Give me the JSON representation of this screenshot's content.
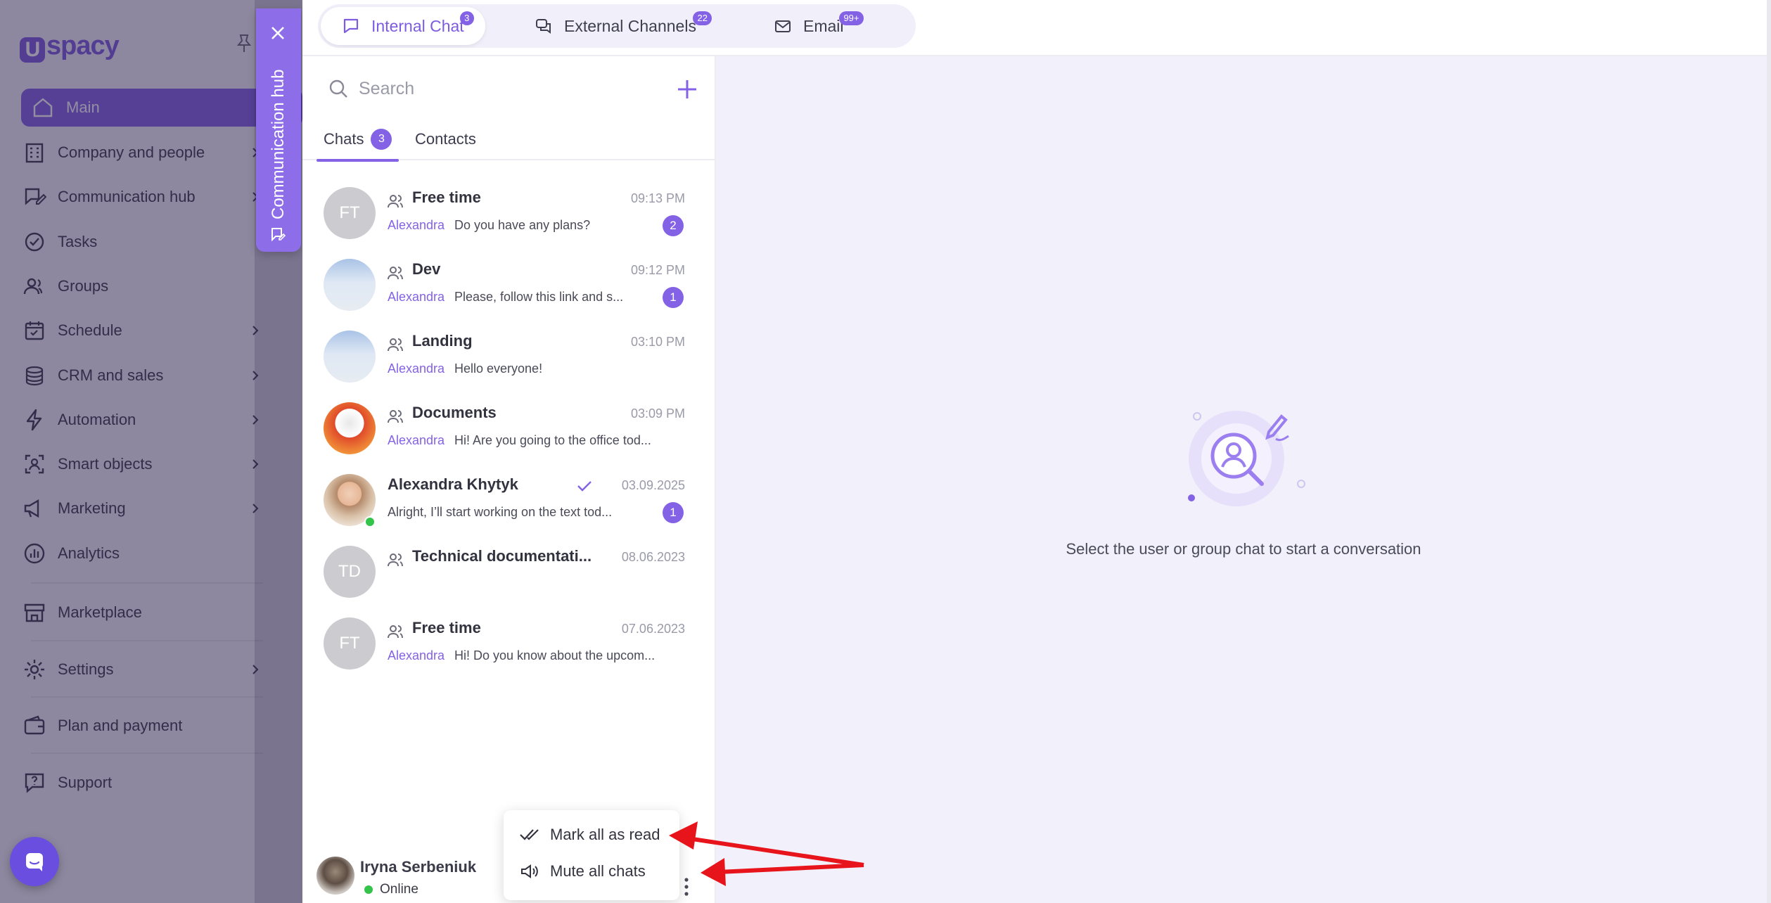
{
  "sidebar": {
    "logo": "spacy",
    "items": [
      {
        "label": "Main"
      },
      {
        "label": "Company and people"
      },
      {
        "label": "Communication hub"
      },
      {
        "label": "Tasks"
      },
      {
        "label": "Groups"
      },
      {
        "label": "Schedule"
      },
      {
        "label": "CRM and sales"
      },
      {
        "label": "Automation"
      },
      {
        "label": "Smart objects"
      },
      {
        "label": "Marketing"
      },
      {
        "label": "Analytics"
      },
      {
        "label": "Marketplace"
      },
      {
        "label": "Settings"
      },
      {
        "label": "Plan and payment"
      },
      {
        "label": "Support"
      }
    ],
    "hub_tab_label": "Communication hub"
  },
  "top_tabs": [
    {
      "label": "Internal Chat",
      "count": "3"
    },
    {
      "label": "External Channels",
      "count": "22"
    },
    {
      "label": "Email",
      "count": "99+"
    }
  ],
  "search": {
    "placeholder": "Search"
  },
  "list_tabs": {
    "chats_label": "Chats",
    "chats_count": "3",
    "contacts_label": "Contacts"
  },
  "chats": [
    {
      "initials": "FT",
      "name": "Free time",
      "time": "09:13 PM",
      "author": "Alexandra",
      "preview": "Do you have any plans?",
      "unread": "2"
    },
    {
      "name": "Dev",
      "time": "09:12 PM",
      "author": "Alexandra",
      "preview": "Please, follow this link and s...",
      "unread": "1"
    },
    {
      "name": "Landing",
      "time": "03:10 PM",
      "author": "Alexandra",
      "preview": "Hello everyone!"
    },
    {
      "name": "Documents",
      "time": "03:09 PM",
      "author": "Alexandra",
      "preview": "Hi! Are you going to the office tod..."
    },
    {
      "name": "Alexandra Khytyk",
      "time": "03.09.2025",
      "preview": "Alright, I’ll start working on the text tod...",
      "unread": "1"
    },
    {
      "initials": "TD",
      "name": "Technical documentati...",
      "time": "08.06.2023"
    },
    {
      "initials": "FT",
      "name": "Free time",
      "time": "07.06.2023",
      "author": "Alexandra",
      "preview": "Hi! Do you know about the upcom..."
    }
  ],
  "user": {
    "name": "Iryna Serbeniuk",
    "status": "Online"
  },
  "menu": {
    "mark_read": "Mark all as read",
    "mute": "Mute all chats"
  },
  "empty_state": {
    "text": "Select the user or group chat to start a conversation"
  },
  "colors": {
    "accent": "#8462e6",
    "online": "#34c34b",
    "annotation_arrow": "#e8141b"
  }
}
